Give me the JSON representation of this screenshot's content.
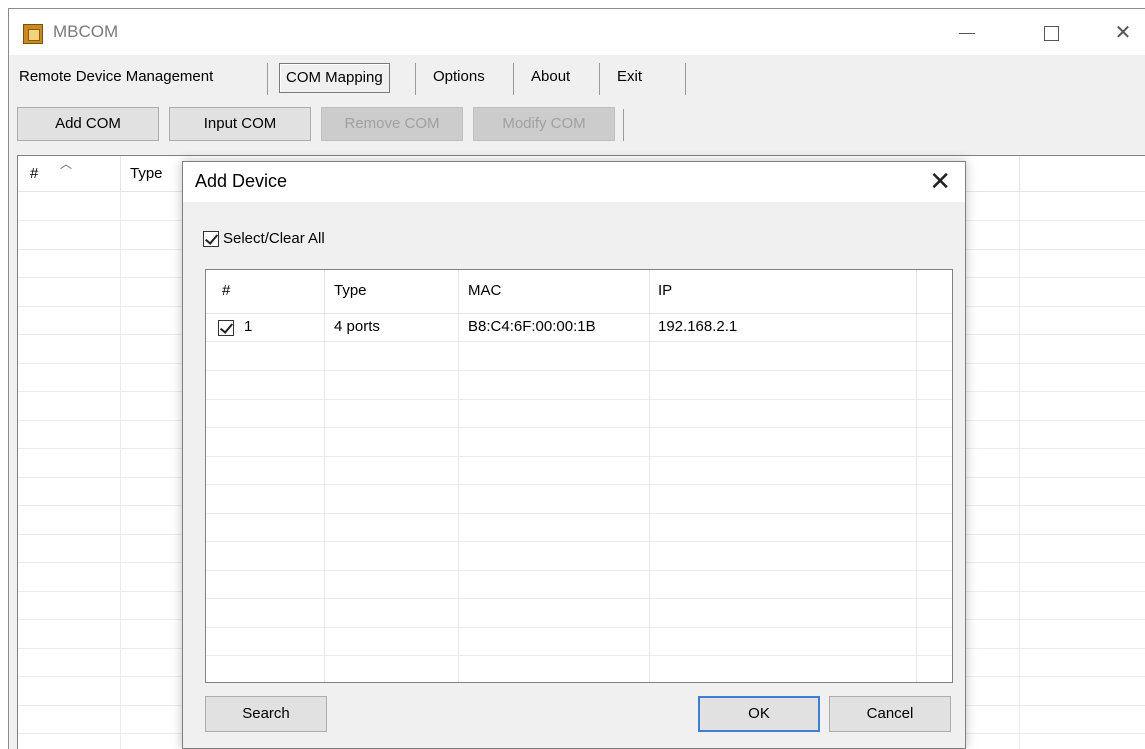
{
  "window": {
    "title": "MBCOM",
    "controls": {
      "minimize": "minimize-icon",
      "maximize": "maximize-icon",
      "close": "close-icon"
    }
  },
  "menu": {
    "items": [
      {
        "label": "Remote Device Management"
      },
      {
        "label": "COM Mapping"
      },
      {
        "label": "Options"
      },
      {
        "label": "About"
      },
      {
        "label": "Exit"
      }
    ]
  },
  "toolbar": {
    "add_com": "Add COM",
    "input_com": "Input COM",
    "remove_com": "Remove COM",
    "modify_com": "Modify COM"
  },
  "main_list": {
    "columns": [
      "#",
      "Type"
    ]
  },
  "dialog": {
    "title": "Add Device",
    "close_glyph": "✕",
    "select_all_label": "Select/Clear All",
    "select_all_checked": true,
    "columns": [
      "#",
      "Type",
      "MAC",
      "IP"
    ],
    "rows": [
      {
        "checked": true,
        "num": "1",
        "type": "4 ports",
        "mac": "B8:C4:6F:00:00:1B",
        "ip": "192.168.2.1"
      }
    ],
    "search_label": "Search",
    "ok_label": "OK",
    "cancel_label": "Cancel"
  },
  "colors": {
    "dialog_bg": "#f0f0f0",
    "default_button_border": "#3c7fd4"
  }
}
